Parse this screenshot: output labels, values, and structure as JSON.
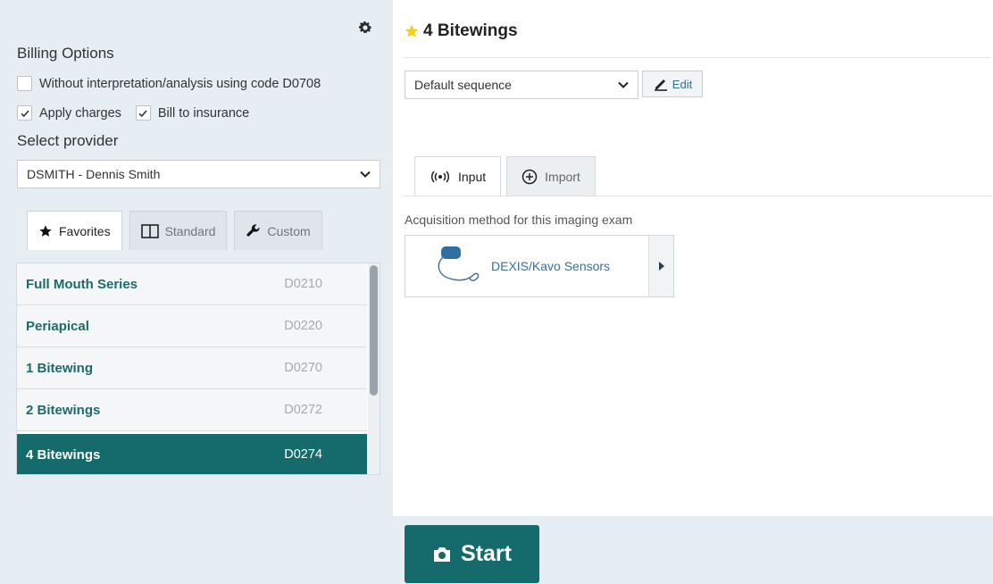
{
  "left_panel": {
    "billing_title": "Billing Options",
    "options": {
      "without_interpretation": {
        "label": "Without interpretation/analysis using code D0708",
        "checked": false
      },
      "apply_charges": {
        "label": "Apply charges",
        "checked": true
      },
      "bill_to_insurance": {
        "label": "Bill to insurance",
        "checked": true
      }
    },
    "provider_label": "Select provider",
    "provider_value": "DSMITH - Dennis Smith",
    "tabs": [
      {
        "label": "Favorites",
        "icon": "star-icon",
        "active": true
      },
      {
        "label": "Standard",
        "icon": "columns-icon",
        "active": false
      },
      {
        "label": "Custom",
        "icon": "wrench-icon",
        "active": false
      }
    ],
    "procedures": [
      {
        "name": "Full Mouth Series",
        "code": "D0210",
        "selected": false
      },
      {
        "name": "Periapical",
        "code": "D0220",
        "selected": false
      },
      {
        "name": "1 Bitewing",
        "code": "D0270",
        "selected": false
      },
      {
        "name": "2 Bitewings",
        "code": "D0272",
        "selected": false
      },
      {
        "name": "4 Bitewings",
        "code": "D0274",
        "selected": true
      }
    ]
  },
  "right_panel": {
    "title": "4 Bitewings",
    "sequence_value": "Default sequence",
    "edit_label": "Edit",
    "tabs": [
      {
        "label": "Input",
        "icon": "radio-signal-icon",
        "active": true
      },
      {
        "label": "Import",
        "icon": "plus-circle-icon",
        "active": false
      }
    ],
    "acquisition_label": "Acquisition method for this imaging exam",
    "acquisition_device": "DEXIS/Kavo Sensors",
    "start_label": "Start"
  },
  "colors": {
    "accent": "#156b6b",
    "panel_bg": "#e6edf3",
    "star": "#f2d21e",
    "link": "#3a6f95"
  }
}
